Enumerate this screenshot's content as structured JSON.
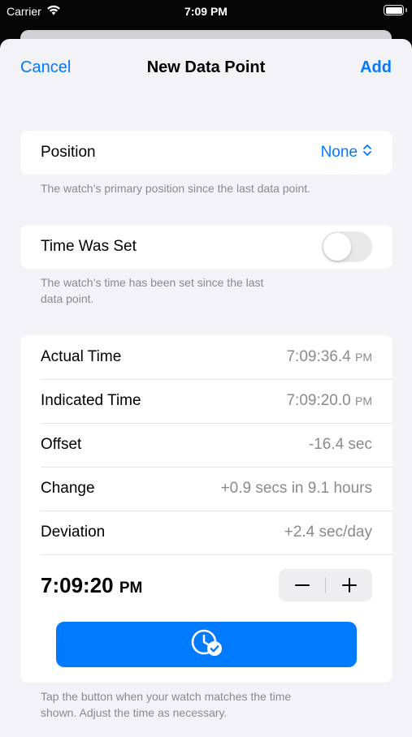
{
  "status_bar": {
    "carrier": "Carrier",
    "time": "7:09 PM"
  },
  "nav": {
    "cancel": "Cancel",
    "title": "New Data Point",
    "add": "Add"
  },
  "position": {
    "label": "Position",
    "value": "None",
    "footer": "The watch’s primary position since the last data point."
  },
  "time_was_set": {
    "label": "Time Was Set",
    "on": false,
    "footer_line1": "The watch’s time has been set since the last",
    "footer_line2": "data point."
  },
  "readings": {
    "actual_time_label": "Actual Time",
    "actual_time_value": "7:09:36.4",
    "actual_time_ampm": "PM",
    "indicated_time_label": "Indicated Time",
    "indicated_time_value": "7:09:20.0",
    "indicated_time_ampm": "PM",
    "offset_label": "Offset",
    "offset_value": "-16.4 sec",
    "change_label": "Change",
    "change_value": "+0.9 secs in 9.1 hours",
    "deviation_label": "Deviation",
    "deviation_value": "+2.4 sec/day"
  },
  "adjust": {
    "time": "7:09:20",
    "ampm": "PM"
  },
  "bottom_footer": {
    "line1": "Tap the button when your watch matches the time",
    "line2": "shown. Adjust the time as necessary."
  },
  "colors": {
    "accent": "#007aff",
    "background": "#f2f2f7",
    "secondary_text": "#8a8a8e"
  },
  "icons": {
    "match": "clock-checkmark-icon",
    "decrement": "minus-icon",
    "increment": "plus-icon",
    "picker": "chevron-up-down-icon"
  }
}
